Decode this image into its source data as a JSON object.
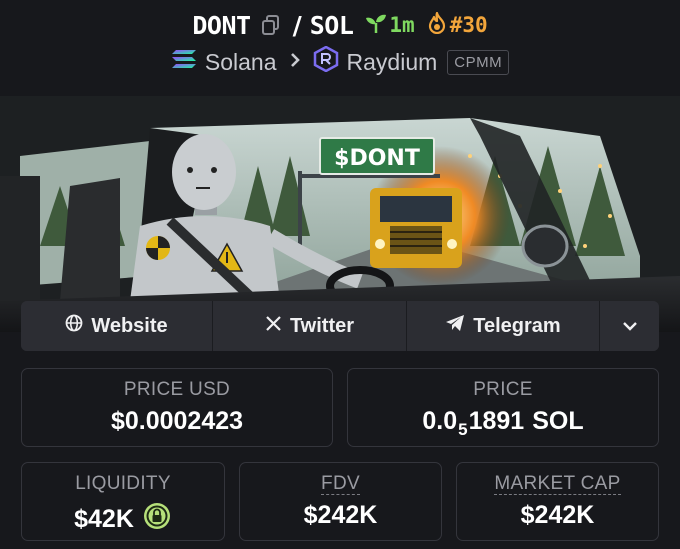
{
  "header": {
    "token_symbol": "DONT",
    "separator": "/",
    "quote_symbol": "SOL",
    "age": "1m",
    "rank": "#30",
    "chain": "Solana",
    "dex": "Raydium",
    "pool_type": "CPMM",
    "icons": {
      "copy": "copy-icon",
      "age": "seedling-icon",
      "rank": "flame-icon",
      "chain": "solana-logo-icon",
      "dex": "raydium-logo-icon",
      "breadcrumb": "chevron-right-icon"
    },
    "colors": {
      "age": "#7fd960",
      "rank": "#f2a53b"
    }
  },
  "banner": {
    "sign_text": "$DONT"
  },
  "links": {
    "website": "Website",
    "twitter": "Twitter",
    "telegram": "Telegram",
    "icons": {
      "website": "globe-icon",
      "twitter": "x-logo-icon",
      "telegram": "telegram-plane-icon",
      "more": "chevron-down-icon"
    }
  },
  "stats": {
    "price_usd": {
      "label": "PRICE USD",
      "value": "$0.0002423"
    },
    "price_native": {
      "label": "PRICE",
      "prefix": "0.0",
      "zeros": "5",
      "digits": "1891",
      "unit": "SOL"
    },
    "liquidity": {
      "label": "LIQUIDITY",
      "value": "$42K",
      "icon": "lock-icon"
    },
    "fdv": {
      "label": "FDV",
      "value": "$242K"
    },
    "market_cap": {
      "label": "MARKET CAP",
      "value": "$242K"
    }
  }
}
